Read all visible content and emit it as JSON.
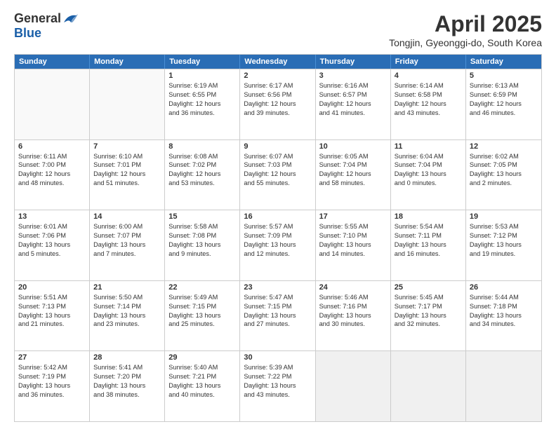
{
  "logo": {
    "general": "General",
    "blue": "Blue"
  },
  "title": "April 2025",
  "subtitle": "Tongjin, Gyeonggi-do, South Korea",
  "headers": [
    "Sunday",
    "Monday",
    "Tuesday",
    "Wednesday",
    "Thursday",
    "Friday",
    "Saturday"
  ],
  "weeks": [
    [
      {
        "day": "",
        "info": ""
      },
      {
        "day": "",
        "info": ""
      },
      {
        "day": "1",
        "info": "Sunrise: 6:19 AM\nSunset: 6:55 PM\nDaylight: 12 hours\nand 36 minutes."
      },
      {
        "day": "2",
        "info": "Sunrise: 6:17 AM\nSunset: 6:56 PM\nDaylight: 12 hours\nand 39 minutes."
      },
      {
        "day": "3",
        "info": "Sunrise: 6:16 AM\nSunset: 6:57 PM\nDaylight: 12 hours\nand 41 minutes."
      },
      {
        "day": "4",
        "info": "Sunrise: 6:14 AM\nSunset: 6:58 PM\nDaylight: 12 hours\nand 43 minutes."
      },
      {
        "day": "5",
        "info": "Sunrise: 6:13 AM\nSunset: 6:59 PM\nDaylight: 12 hours\nand 46 minutes."
      }
    ],
    [
      {
        "day": "6",
        "info": "Sunrise: 6:11 AM\nSunset: 7:00 PM\nDaylight: 12 hours\nand 48 minutes."
      },
      {
        "day": "7",
        "info": "Sunrise: 6:10 AM\nSunset: 7:01 PM\nDaylight: 12 hours\nand 51 minutes."
      },
      {
        "day": "8",
        "info": "Sunrise: 6:08 AM\nSunset: 7:02 PM\nDaylight: 12 hours\nand 53 minutes."
      },
      {
        "day": "9",
        "info": "Sunrise: 6:07 AM\nSunset: 7:03 PM\nDaylight: 12 hours\nand 55 minutes."
      },
      {
        "day": "10",
        "info": "Sunrise: 6:05 AM\nSunset: 7:04 PM\nDaylight: 12 hours\nand 58 minutes."
      },
      {
        "day": "11",
        "info": "Sunrise: 6:04 AM\nSunset: 7:04 PM\nDaylight: 13 hours\nand 0 minutes."
      },
      {
        "day": "12",
        "info": "Sunrise: 6:02 AM\nSunset: 7:05 PM\nDaylight: 13 hours\nand 2 minutes."
      }
    ],
    [
      {
        "day": "13",
        "info": "Sunrise: 6:01 AM\nSunset: 7:06 PM\nDaylight: 13 hours\nand 5 minutes."
      },
      {
        "day": "14",
        "info": "Sunrise: 6:00 AM\nSunset: 7:07 PM\nDaylight: 13 hours\nand 7 minutes."
      },
      {
        "day": "15",
        "info": "Sunrise: 5:58 AM\nSunset: 7:08 PM\nDaylight: 13 hours\nand 9 minutes."
      },
      {
        "day": "16",
        "info": "Sunrise: 5:57 AM\nSunset: 7:09 PM\nDaylight: 13 hours\nand 12 minutes."
      },
      {
        "day": "17",
        "info": "Sunrise: 5:55 AM\nSunset: 7:10 PM\nDaylight: 13 hours\nand 14 minutes."
      },
      {
        "day": "18",
        "info": "Sunrise: 5:54 AM\nSunset: 7:11 PM\nDaylight: 13 hours\nand 16 minutes."
      },
      {
        "day": "19",
        "info": "Sunrise: 5:53 AM\nSunset: 7:12 PM\nDaylight: 13 hours\nand 19 minutes."
      }
    ],
    [
      {
        "day": "20",
        "info": "Sunrise: 5:51 AM\nSunset: 7:13 PM\nDaylight: 13 hours\nand 21 minutes."
      },
      {
        "day": "21",
        "info": "Sunrise: 5:50 AM\nSunset: 7:14 PM\nDaylight: 13 hours\nand 23 minutes."
      },
      {
        "day": "22",
        "info": "Sunrise: 5:49 AM\nSunset: 7:15 PM\nDaylight: 13 hours\nand 25 minutes."
      },
      {
        "day": "23",
        "info": "Sunrise: 5:47 AM\nSunset: 7:15 PM\nDaylight: 13 hours\nand 27 minutes."
      },
      {
        "day": "24",
        "info": "Sunrise: 5:46 AM\nSunset: 7:16 PM\nDaylight: 13 hours\nand 30 minutes."
      },
      {
        "day": "25",
        "info": "Sunrise: 5:45 AM\nSunset: 7:17 PM\nDaylight: 13 hours\nand 32 minutes."
      },
      {
        "day": "26",
        "info": "Sunrise: 5:44 AM\nSunset: 7:18 PM\nDaylight: 13 hours\nand 34 minutes."
      }
    ],
    [
      {
        "day": "27",
        "info": "Sunrise: 5:42 AM\nSunset: 7:19 PM\nDaylight: 13 hours\nand 36 minutes."
      },
      {
        "day": "28",
        "info": "Sunrise: 5:41 AM\nSunset: 7:20 PM\nDaylight: 13 hours\nand 38 minutes."
      },
      {
        "day": "29",
        "info": "Sunrise: 5:40 AM\nSunset: 7:21 PM\nDaylight: 13 hours\nand 40 minutes."
      },
      {
        "day": "30",
        "info": "Sunrise: 5:39 AM\nSunset: 7:22 PM\nDaylight: 13 hours\nand 43 minutes."
      },
      {
        "day": "",
        "info": ""
      },
      {
        "day": "",
        "info": ""
      },
      {
        "day": "",
        "info": ""
      }
    ]
  ]
}
